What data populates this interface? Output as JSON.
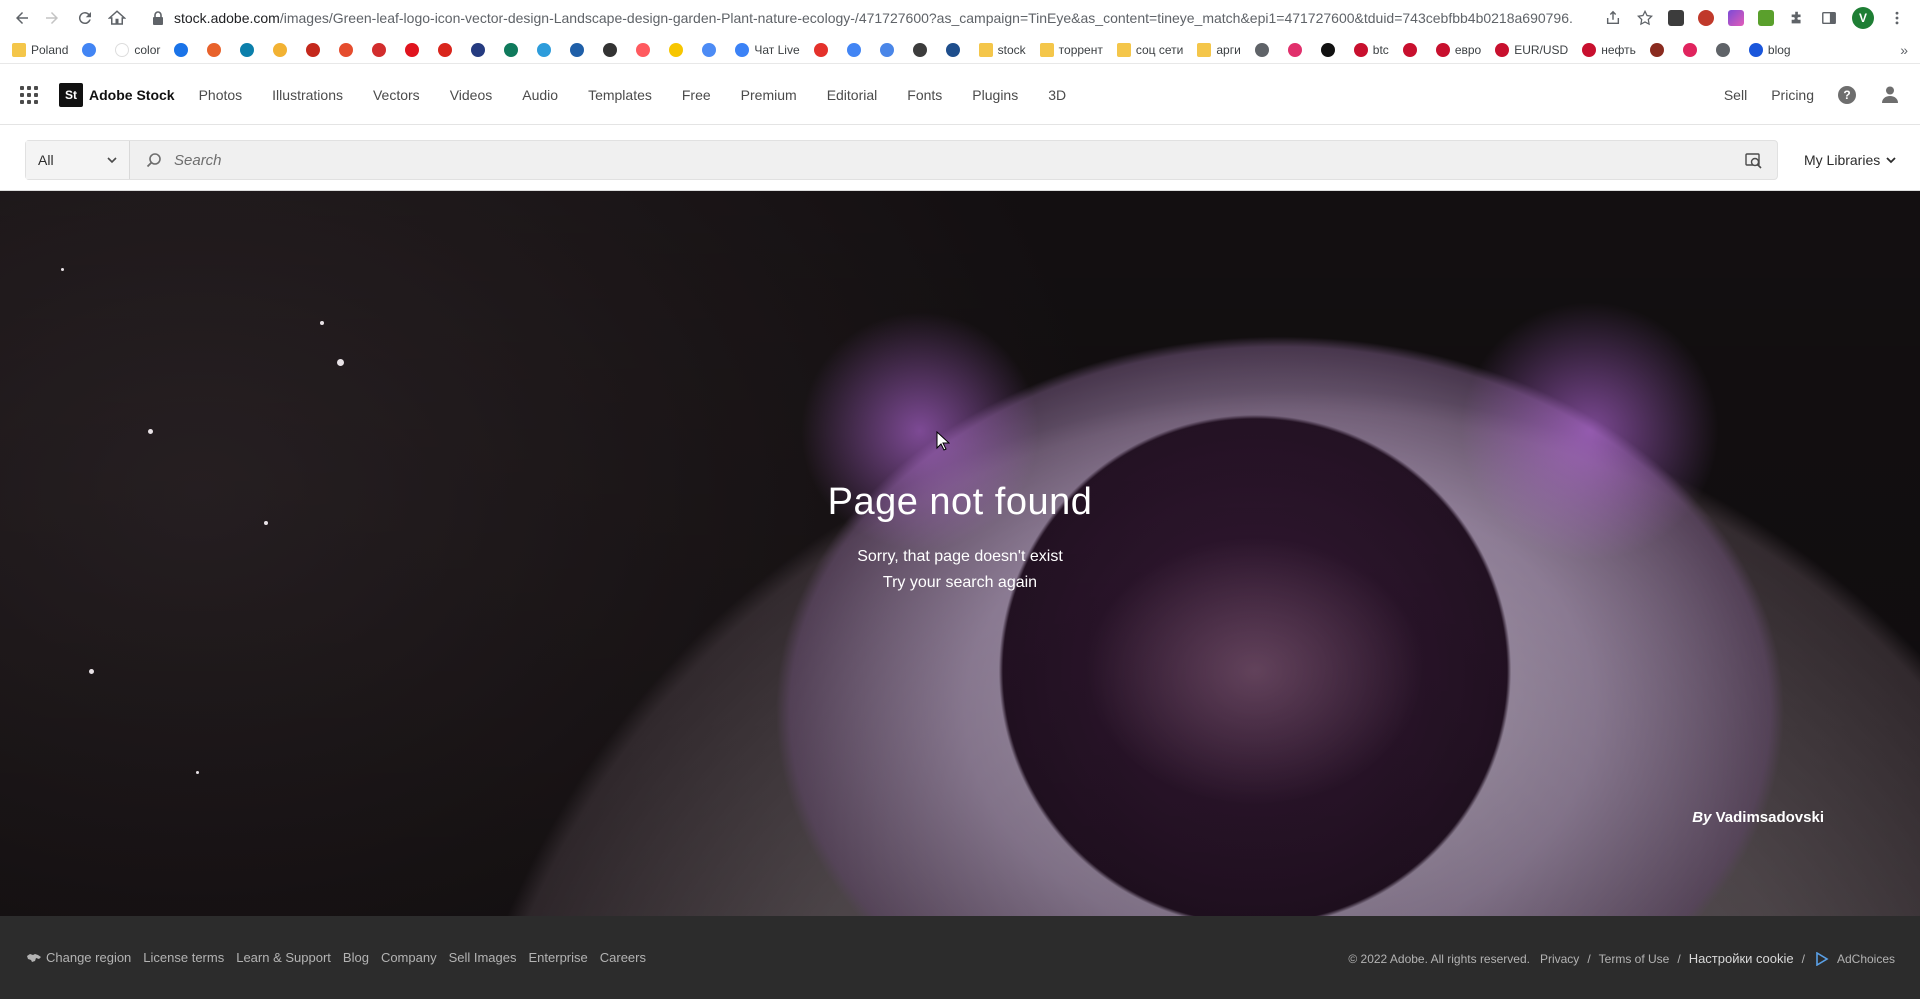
{
  "browser": {
    "url_host": "stock.adobe.com",
    "url_path": "/images/Green-leaf-logo-icon-vector-design-Landscape-design-garden-Plant-nature-ecology-/471727600?as_campaign=TinEye&as_content=tineye_match&epi1=471727600&tduid=743cebfbb4b0218a690796...",
    "profile_letter": "V",
    "bookmarks": [
      {
        "label": "Poland",
        "icon": "folder",
        "color": "#f4c64a"
      },
      {
        "label": "",
        "icon": "site",
        "color": "#4285f4"
      },
      {
        "label": "color",
        "icon": "blank",
        "color": "#ffffff"
      },
      {
        "label": "",
        "icon": "site",
        "color": "#1a73e8"
      },
      {
        "label": "",
        "icon": "site",
        "color": "#e8622b"
      },
      {
        "label": "",
        "icon": "site",
        "color": "#0b7fab"
      },
      {
        "label": "",
        "icon": "site",
        "color": "#f2b233"
      },
      {
        "label": "",
        "icon": "site",
        "color": "#c4281c"
      },
      {
        "label": "",
        "icon": "site",
        "color": "#e54d2e"
      },
      {
        "label": "",
        "icon": "site",
        "color": "#d22d2d"
      },
      {
        "label": "",
        "icon": "site",
        "color": "#e0141e"
      },
      {
        "label": "",
        "icon": "site",
        "color": "#d9251c"
      },
      {
        "label": "",
        "icon": "site",
        "color": "#253b80"
      },
      {
        "label": "",
        "icon": "site",
        "color": "#0f7a5c"
      },
      {
        "label": "",
        "icon": "site",
        "color": "#2d9cdb"
      },
      {
        "label": "",
        "icon": "site",
        "color": "#1f5fa8"
      },
      {
        "label": "",
        "icon": "site",
        "color": "#333333"
      },
      {
        "label": "",
        "icon": "site",
        "color": "#ff5a5f"
      },
      {
        "label": "",
        "icon": "site",
        "color": "#f7c600"
      },
      {
        "label": "",
        "icon": "site",
        "color": "#4c8bf5"
      },
      {
        "label": "Чат Live",
        "icon": "site",
        "color": "#3b82f6"
      },
      {
        "label": "",
        "icon": "site",
        "color": "#e4312b"
      },
      {
        "label": "",
        "icon": "site",
        "color": "#4285f4"
      },
      {
        "label": "",
        "icon": "site",
        "color": "#4a86e8"
      },
      {
        "label": "",
        "icon": "site",
        "color": "#3c3c3c"
      },
      {
        "label": "",
        "icon": "site",
        "color": "#1e4e8c"
      },
      {
        "label": "stock",
        "icon": "folder",
        "color": "#f4c64a"
      },
      {
        "label": "торрент",
        "icon": "folder",
        "color": "#f4c64a"
      },
      {
        "label": "соц сети",
        "icon": "folder",
        "color": "#f4c64a"
      },
      {
        "label": "арги",
        "icon": "folder",
        "color": "#f4c64a"
      },
      {
        "label": "",
        "icon": "site",
        "color": "#5f6368"
      },
      {
        "label": "",
        "icon": "site",
        "color": "#e1306c"
      },
      {
        "label": "",
        "icon": "site",
        "color": "#111111"
      },
      {
        "label": "btc",
        "icon": "site",
        "color": "#c8102e"
      },
      {
        "label": "",
        "icon": "site",
        "color": "#c8102e"
      },
      {
        "label": "евро",
        "icon": "site",
        "color": "#c8102e"
      },
      {
        "label": "EUR/USD",
        "icon": "site",
        "color": "#c8102e"
      },
      {
        "label": "нефть",
        "icon": "site",
        "color": "#c8102e"
      },
      {
        "label": "",
        "icon": "site",
        "color": "#8a2b1f"
      },
      {
        "label": "",
        "icon": "site",
        "color": "#e0245e"
      },
      {
        "label": "",
        "icon": "site",
        "color": "#5f6368"
      },
      {
        "label": "blog",
        "icon": "site",
        "color": "#1a56db"
      }
    ]
  },
  "header": {
    "logo_mark": "St",
    "logo_text": "Adobe Stock",
    "nav": [
      "Photos",
      "Illustrations",
      "Vectors",
      "Videos",
      "Audio",
      "Templates",
      "Free",
      "Premium",
      "Editorial",
      "Fonts",
      "Plugins",
      "3D"
    ],
    "sell": "Sell",
    "pricing": "Pricing",
    "help": "?"
  },
  "search": {
    "scope": "All",
    "placeholder": "Search",
    "my_libraries": "My Libraries"
  },
  "hero": {
    "title": "Page not found",
    "line1": "Sorry, that page doesn't exist",
    "line2": "Try your search again",
    "credit_prefix": "By",
    "credit_name": "Vadimsadovski"
  },
  "footer": {
    "left": [
      "Change region",
      "License terms",
      "Learn & Support",
      "Blog",
      "Company",
      "Sell Images",
      "Enterprise",
      "Careers"
    ],
    "copyright": "© 2022 Adobe. All rights reserved.",
    "privacy": "Privacy",
    "terms": "Terms of Use",
    "cookie": "Настройки cookie",
    "adchoices": "AdChoices",
    "sep": "/"
  }
}
